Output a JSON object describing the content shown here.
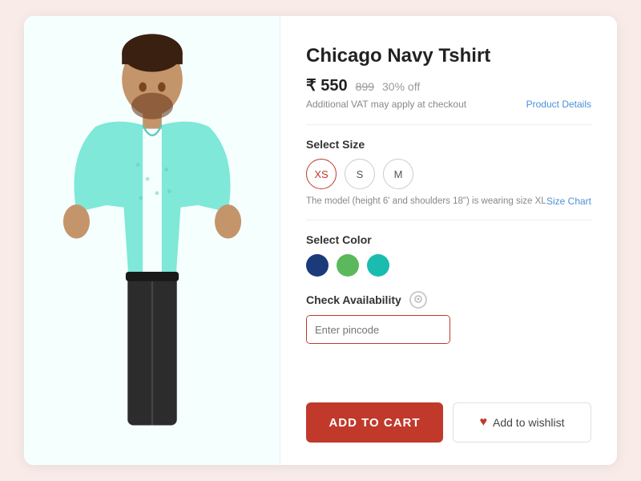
{
  "product": {
    "title": "Chicago Navy Tshirt",
    "price_current": "₹ 550",
    "price_original": "899",
    "discount": "30% off",
    "vat_note": "Additional VAT may apply at checkout",
    "product_details_link": "Product Details",
    "size_section_label": "Select Size",
    "sizes": [
      {
        "label": "XS",
        "selected": true
      },
      {
        "label": "S",
        "selected": false
      },
      {
        "label": "M",
        "selected": false
      }
    ],
    "model_note": "The model (height 6' and shoulders 18\") is wearing size XL",
    "size_chart_link": "Size Chart",
    "color_section_label": "Select Color",
    "colors": [
      {
        "name": "navy",
        "class": "color-navy"
      },
      {
        "name": "green",
        "class": "color-green"
      },
      {
        "name": "teal",
        "class": "color-teal"
      }
    ],
    "availability_label": "Check Availability",
    "pincode_placeholder": "Enter pincode",
    "add_to_cart_label": "ADD TO CART",
    "add_to_wishlist_label": "Add to wishlist"
  }
}
